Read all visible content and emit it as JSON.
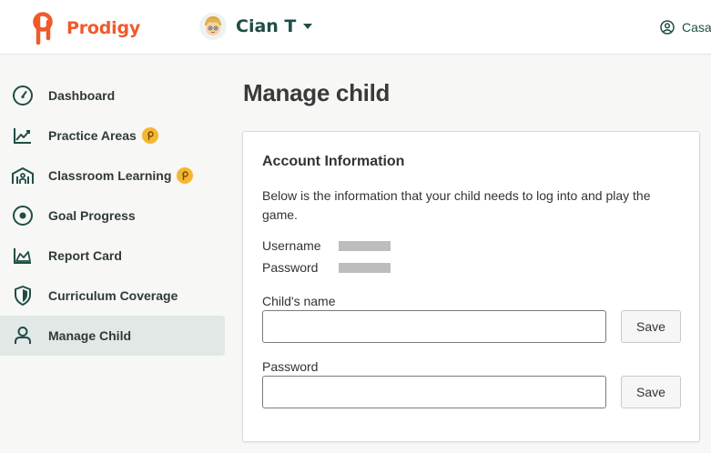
{
  "header": {
    "brand": "Prodigy",
    "child_name": "Cian T",
    "account_label": "Casa"
  },
  "sidebar": {
    "items": [
      {
        "label": "Dashboard",
        "icon": "gauge-icon",
        "premium": false,
        "active": false
      },
      {
        "label": "Practice Areas",
        "icon": "trend-line-icon",
        "premium": true,
        "active": false
      },
      {
        "label": "Classroom Learning",
        "icon": "classroom-icon",
        "premium": true,
        "active": false
      },
      {
        "label": "Goal Progress",
        "icon": "target-icon",
        "premium": false,
        "active": false
      },
      {
        "label": "Report Card",
        "icon": "area-chart-icon",
        "premium": false,
        "active": false
      },
      {
        "label": "Curriculum Coverage",
        "icon": "shield-icon",
        "premium": false,
        "active": false
      },
      {
        "label": "Manage Child",
        "icon": "person-icon",
        "premium": false,
        "active": true
      }
    ]
  },
  "main": {
    "title": "Manage child",
    "card": {
      "title": "Account Information",
      "description": "Below is the information that your child needs to log into and play the game.",
      "username_label": "Username",
      "password_label": "Password",
      "childs_name_label": "Child's name",
      "childs_name_value": "",
      "new_password_label": "Password",
      "new_password_value": "",
      "save_label": "Save"
    }
  },
  "colors": {
    "brand": "#f05a2a",
    "nav_text": "#2f3a38",
    "header_text": "#1f4e46",
    "active_bg": "#e2e8e6",
    "premium_badge": "#f5b731",
    "redacted": "#bdbdbd"
  }
}
